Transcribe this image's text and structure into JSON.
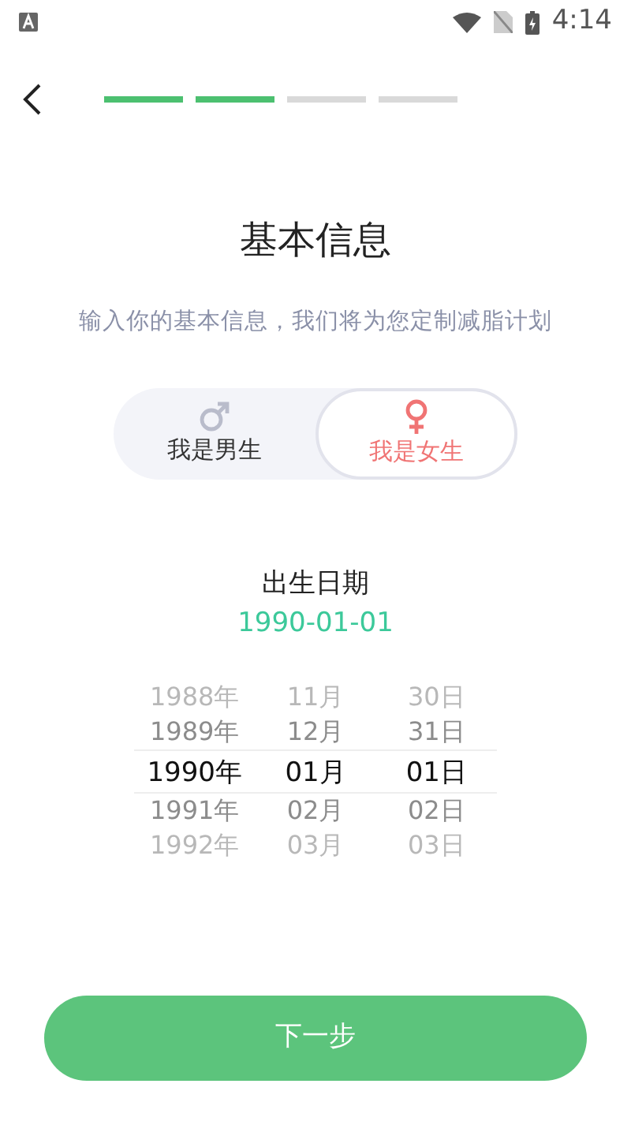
{
  "status_bar": {
    "time": "4:14"
  },
  "progress_steps": [
    {
      "done": true
    },
    {
      "done": true
    },
    {
      "done": false
    },
    {
      "done": false
    }
  ],
  "title": "基本信息",
  "subtitle": "输入你的基本信息，我们将为您定制减脂计划",
  "gender_options": [
    {
      "kind": "male",
      "label": "我是男生",
      "selected": false
    },
    {
      "kind": "female",
      "label": "我是女生",
      "selected": true
    }
  ],
  "birth_date": {
    "label": "出生日期",
    "value": "1990-01-01"
  },
  "date_picker": {
    "columns": [
      {
        "rows": [
          {
            "text": "1988年",
            "selected": false
          },
          {
            "text": "1989年",
            "selected": false
          },
          {
            "text": "1990年",
            "selected": true
          },
          {
            "text": "1991年",
            "selected": false
          },
          {
            "text": "1992年",
            "selected": false
          }
        ]
      },
      {
        "rows": [
          {
            "text": "11月",
            "selected": false
          },
          {
            "text": "12月",
            "selected": false
          },
          {
            "text": "01月",
            "selected": true
          },
          {
            "text": "02月",
            "selected": false
          },
          {
            "text": "03月",
            "selected": false
          }
        ]
      },
      {
        "rows": [
          {
            "text": "30日",
            "selected": false
          },
          {
            "text": "31日",
            "selected": false
          },
          {
            "text": "01日",
            "selected": true
          },
          {
            "text": "02日",
            "selected": false
          },
          {
            "text": "03日",
            "selected": false
          }
        ]
      }
    ]
  },
  "next_button": "下一步"
}
